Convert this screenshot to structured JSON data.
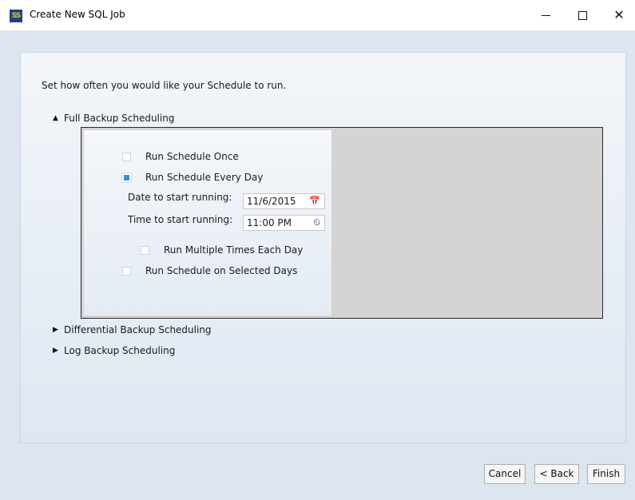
{
  "window": {
    "title": "Create New SQL Job",
    "icon_text": "SS",
    "icon_name": "app-logo-icon",
    "close_glyph": "✕"
  },
  "instruction": "Set how often you would like your Schedule to run.",
  "sections": {
    "full": {
      "label": "Full Backup Scheduling",
      "expanded": true,
      "toggle_icon": "expanded-triangle-icon"
    },
    "differential": {
      "label": "Differential Backup Scheduling",
      "expanded": false,
      "toggle_icon": "collapsed-triangle-icon"
    },
    "log": {
      "label": "Log Backup Scheduling",
      "expanded": false,
      "toggle_icon": "collapsed-triangle-icon"
    }
  },
  "schedule": {
    "run_once": {
      "label": "Run Schedule Once",
      "checked": false
    },
    "run_every_day": {
      "label": "Run Schedule Every Day",
      "checked": true
    },
    "date_label": "Date to start running:",
    "date_value": "11/6/2015",
    "time_label": "Time to start running:",
    "time_value": "11:00 PM",
    "run_multiple": {
      "label": "Run Multiple Times Each Day",
      "checked": false
    },
    "run_selected_days": {
      "label": "Run Schedule on Selected Days",
      "checked": false
    }
  },
  "buttons": {
    "cancel": "Cancel",
    "back": "< Back",
    "finish": "Finish"
  },
  "colors": {
    "accent": "#2a9ad6",
    "background": "#dde6f0",
    "frame_gray": "#d5d3d3"
  }
}
